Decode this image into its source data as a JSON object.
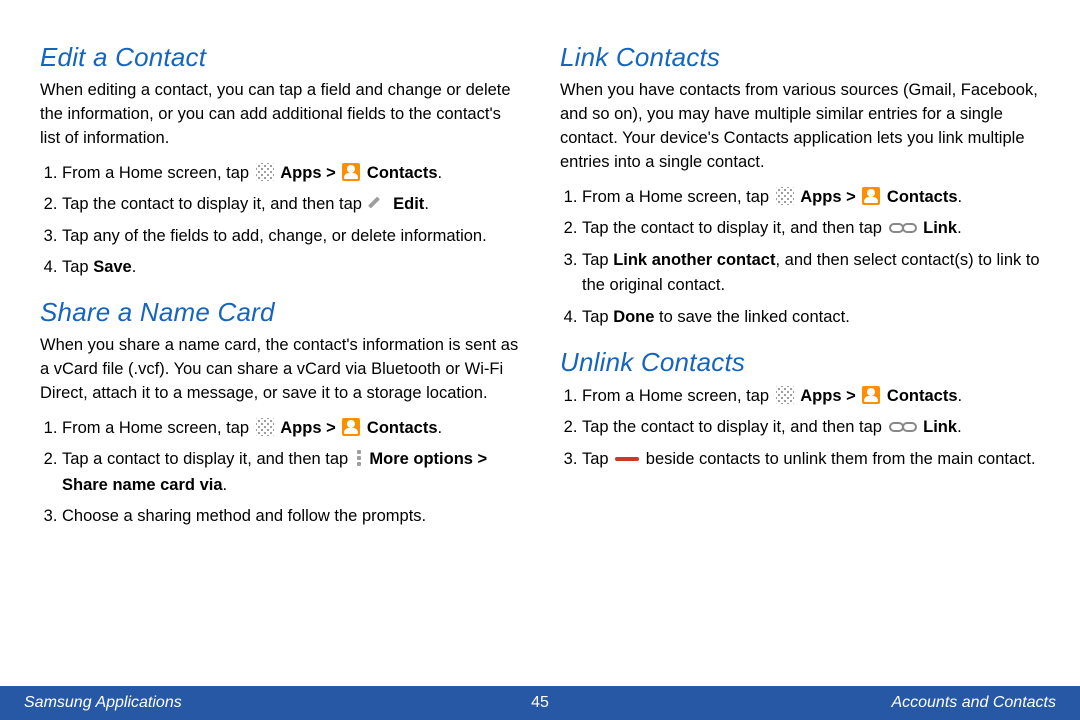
{
  "left": {
    "edit": {
      "title": "Edit a Contact",
      "intro": "When editing a contact, you can tap a field and change or delete the information, or you can add additional fields to the contact's list of information.",
      "s1a": "From a Home screen, tap ",
      "apps": "Apps",
      "gt": " > ",
      "contacts": "Contacts",
      "s2a": "Tap the contact to display it, and then tap ",
      "edit": "Edit",
      "s3": "Tap any of the fields to add, change, or delete information.",
      "s4a": "Tap ",
      "save": "Save"
    },
    "share": {
      "title": "Share a Name Card",
      "intro": "When you share a name card, the contact's information is sent as a vCard file (.vcf). You can share a vCard via Bluetooth or Wi-Fi Direct, attach it to a message, or save it to a storage location.",
      "s1a": "From a Home screen, tap ",
      "apps": "Apps",
      "gt": " > ",
      "contacts": "Contacts",
      "s2a": "Tap a contact to display it, and then tap ",
      "more": "More options",
      "gt2": " > ",
      "sharevia": "Share name card via",
      "s3": "Choose a sharing method and follow the prompts."
    }
  },
  "right": {
    "link": {
      "title": "Link Contacts",
      "intro": "When you have contacts from various sources (Gmail, Facebook, and so on), you may have multiple similar entries for a single contact. Your device's Contacts application lets you link multiple entries into a single contact.",
      "s1a": "From a Home screen, tap ",
      "apps": "Apps",
      "gt": " > ",
      "contacts": "Contacts",
      "s2a": "Tap the contact to display it, and then tap ",
      "linklbl": "Link",
      "s3a": "Tap ",
      "linkanother": "Link another contact",
      "s3b": ", and then select contact(s) to link to the original contact.",
      "s4a": "Tap ",
      "done": "Done",
      "s4b": " to save the linked contact."
    },
    "unlink": {
      "title": "Unlink Contacts",
      "s1a": "From a Home screen, tap ",
      "apps": "Apps",
      "gt": " > ",
      "contacts": "Contacts",
      "s2a": "Tap the contact to display it, and then tap ",
      "linklbl": "Link",
      "s3a": "Tap ",
      "s3b": " beside contacts to unlink them from the main contact."
    }
  },
  "footer": {
    "left": "Samsung Applications",
    "page": "45",
    "right": "Accounts and Contacts"
  }
}
